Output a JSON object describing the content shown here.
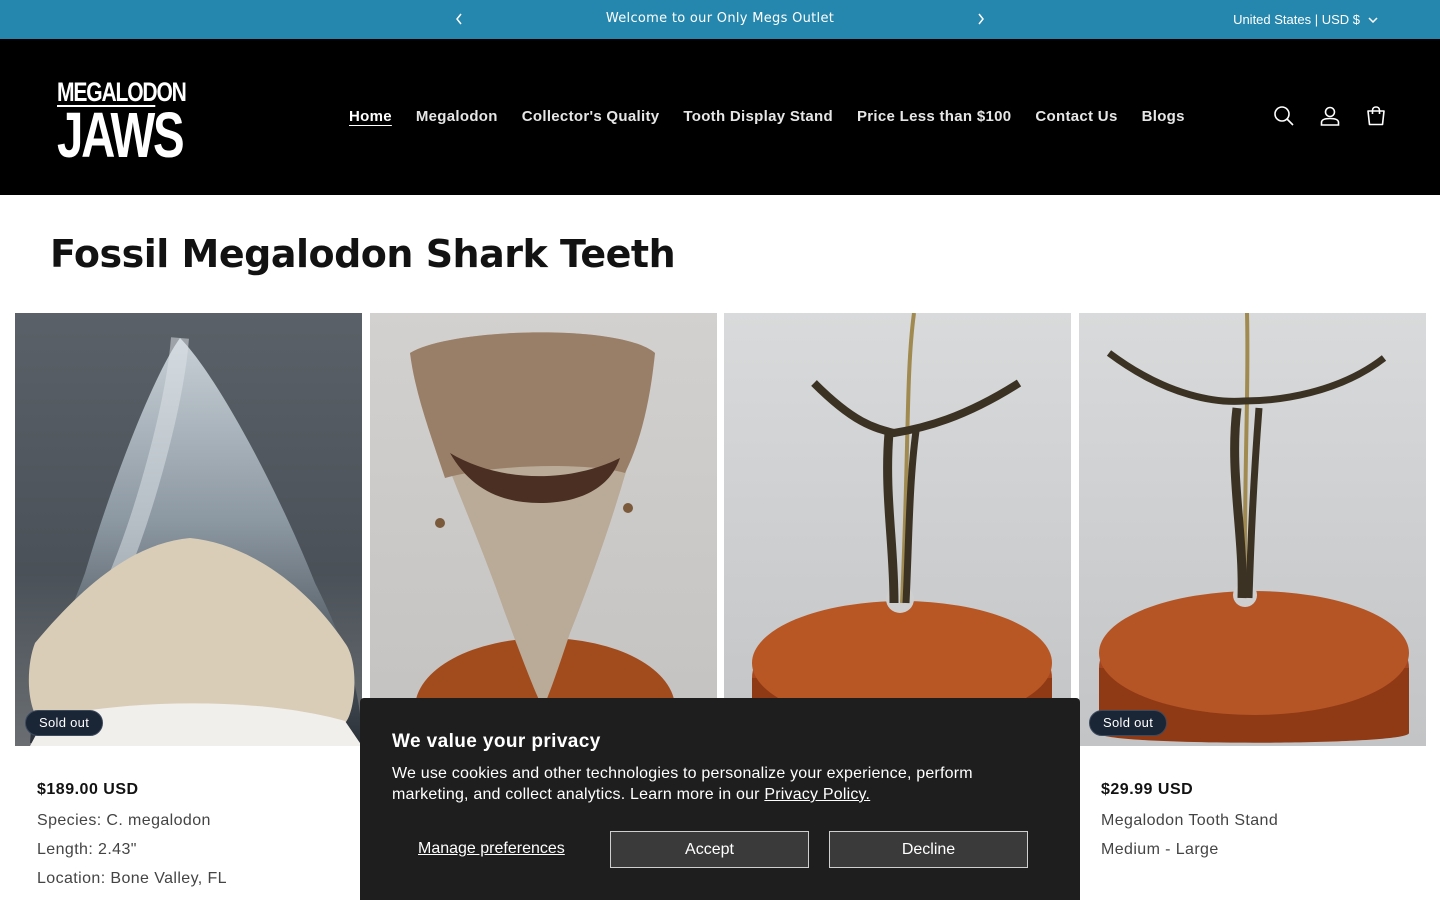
{
  "announcement": {
    "message": "Welcome to our Only Megs Outlet",
    "locale": "United States | USD $"
  },
  "header": {
    "logo_line1": "MEGALODON",
    "logo_line2": "JAWS",
    "nav": [
      {
        "label": "Home",
        "active": true
      },
      {
        "label": "Megalodon"
      },
      {
        "label": "Collector's Quality"
      },
      {
        "label": "Tooth Display Stand"
      },
      {
        "label": "Price Less than $100"
      },
      {
        "label": "Contact Us"
      },
      {
        "label": "Blogs"
      }
    ],
    "icons": [
      "search-icon",
      "account-icon",
      "cart-icon"
    ]
  },
  "main": {
    "title": "Fossil Megalodon Shark Teeth"
  },
  "products": [
    {
      "badge": "Sold out",
      "price": "$189.00 USD",
      "lines": [
        "Species: C. megalodon",
        "Length: 2.43\"",
        "Location: Bone Valley, FL"
      ]
    },
    {
      "badge": "",
      "price": "",
      "lines": []
    },
    {
      "badge": "",
      "price": "",
      "lines": []
    },
    {
      "badge": "Sold out",
      "price": "$29.99 USD",
      "lines": [
        "Megalodon Tooth Stand",
        "Medium - Large"
      ]
    }
  ],
  "cookie": {
    "title": "We value your privacy",
    "body": "We use cookies and other technologies to personalize your experience, perform marketing, and collect analytics. Learn more in our ",
    "link": "Privacy Policy.",
    "manage": "Manage preferences",
    "accept": "Accept",
    "decline": "Decline"
  },
  "colors": {
    "announcement_bg": "#2587ad",
    "header_bg": "#000000",
    "banner_bg": "#1e1e1e",
    "badge_bg": "#1a2535"
  }
}
